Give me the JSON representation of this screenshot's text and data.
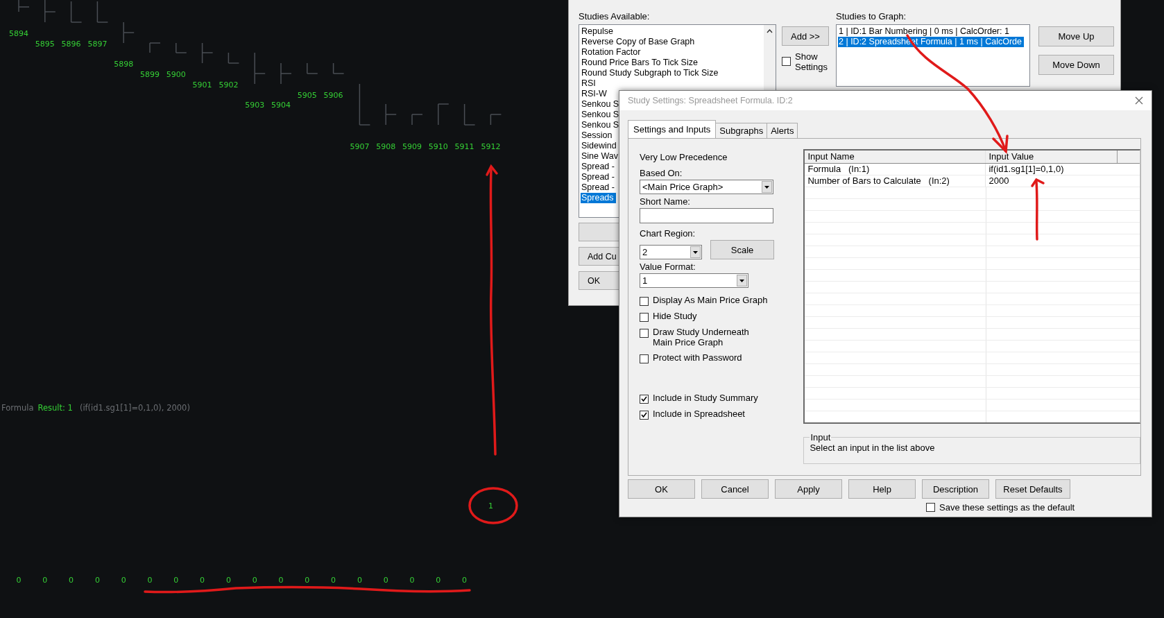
{
  "chart": {
    "bar_labels": [
      "5894",
      "5895",
      "5896",
      "5897",
      "5898",
      "5899",
      "5900",
      "5901",
      "5902",
      "5903",
      "5904",
      "5905",
      "5906",
      "5907",
      "5908",
      "5909",
      "5910",
      "5911",
      "5912"
    ],
    "study_line": {
      "name": "Formula",
      "result": "Result: 1",
      "params": "(if(id1.sg1[1]=0,1,0), 2000)"
    },
    "subgraph_values": [
      "0",
      "0",
      "0",
      "0",
      "0",
      "0",
      "0",
      "0",
      "0",
      "0",
      "0",
      "0",
      "0",
      "0",
      "0",
      "0",
      "0",
      "0",
      "1"
    ]
  },
  "studies_window": {
    "available_label": "Studies Available:",
    "available": [
      {
        "text": "Repulse",
        "selected": false
      },
      {
        "text": "Reverse Copy of Base Graph",
        "selected": false
      },
      {
        "text": "Rotation Factor",
        "selected": false
      },
      {
        "text": "Round Price Bars To Tick Size",
        "selected": false
      },
      {
        "text": "Round Study Subgraph to Tick Size",
        "selected": false
      },
      {
        "text": "RSI",
        "selected": false
      },
      {
        "text": "RSI-W",
        "selected": false
      },
      {
        "text": "Senkou S",
        "selected": false
      },
      {
        "text": "Senkou S",
        "selected": false
      },
      {
        "text": "Senkou S",
        "selected": false
      },
      {
        "text": "Session",
        "selected": false
      },
      {
        "text": "Sidewind",
        "selected": false
      },
      {
        "text": "Sine Wav",
        "selected": false
      },
      {
        "text": "Spread -",
        "selected": false
      },
      {
        "text": "Spread -",
        "selected": false
      },
      {
        "text": "Spread -",
        "selected": false
      },
      {
        "text": "Spreads",
        "selected": true
      }
    ],
    "add_button": "Add >>",
    "show_settings": {
      "label": "Show Settings",
      "checked": false
    },
    "graph_label": "Studies to Graph:",
    "graph": [
      {
        "text": "1 | ID:1  Bar Numbering | 0 ms | CalcOrder: 1",
        "selected": false
      },
      {
        "text": "2 | ID:2  Spreadsheet Formula | 1 ms | CalcOrde",
        "selected": true
      }
    ],
    "move_buttons": [
      "Move Up",
      "Move Down"
    ],
    "bottom_buttons": [
      "Add Cu",
      "OK"
    ]
  },
  "settings_dialog": {
    "title": "Study Settings: Spreadsheet Formula. ID:2",
    "tabs": [
      {
        "label": "Settings and Inputs",
        "selected": true
      },
      {
        "label": "Subgraphs",
        "selected": false
      },
      {
        "label": "Alerts",
        "selected": false
      }
    ],
    "precedence": "Very Low Precedence",
    "based_on": {
      "label": "Based On:",
      "value": "<Main Price Graph>"
    },
    "short_name": {
      "label": "Short Name:"
    },
    "chart_region": {
      "label": "Chart Region:",
      "value": "2"
    },
    "scale_button": "Scale",
    "value_format": {
      "label": "Value Format:",
      "value": "1"
    },
    "options": [
      {
        "label": "Display As Main Price Graph",
        "checked": false
      },
      {
        "label": "Hide Study",
        "checked": false
      },
      {
        "label": "Draw Study Underneath\nMain Price Graph",
        "checked": false
      },
      {
        "label": "Protect with Password",
        "checked": false
      }
    ],
    "includes": [
      {
        "label": "Include in Study Summary",
        "checked": true
      },
      {
        "label": "Include in Spreadsheet",
        "checked": true
      }
    ],
    "inputs": {
      "columns": [
        "Input Name",
        "Input Value"
      ],
      "rows": [
        [
          "Formula   (In:1)",
          "if(id1.sg1[1]=0,1,0)"
        ],
        [
          "Number of Bars to Calculate   (In:2)",
          "2000"
        ]
      ]
    },
    "input_group": {
      "title": "Input",
      "text": "Select an input in the list above"
    },
    "buttons": [
      "OK",
      "Cancel",
      "Apply",
      "Help",
      "Description",
      "Reset Defaults"
    ],
    "save_default": {
      "label": "Save these settings as the default",
      "checked": false
    }
  }
}
